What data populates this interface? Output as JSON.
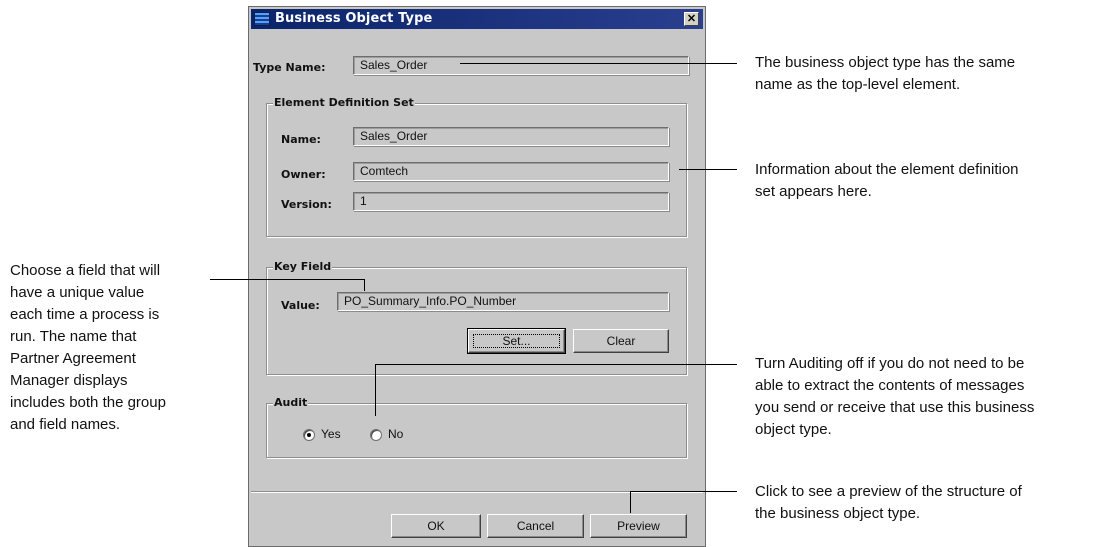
{
  "dialog": {
    "title": "Business Object Type",
    "close_glyph": "✕",
    "type_name": {
      "label": "Type Name:",
      "value": "Sales_Order"
    },
    "element_definition_set": {
      "title": "Element Definition Set",
      "name": {
        "label": "Name:",
        "value": "Sales_Order"
      },
      "owner": {
        "label": "Owner:",
        "value": "Comtech"
      },
      "version": {
        "label": "Version:",
        "value": "1"
      }
    },
    "key_field": {
      "title": "Key Field",
      "value": {
        "label": "Value:",
        "value": "PO_Summary_Info.PO_Number"
      },
      "set_label": "Set...",
      "clear_label": "Clear"
    },
    "audit": {
      "title": "Audit",
      "options": [
        {
          "label": "Yes",
          "selected": true
        },
        {
          "label": "No",
          "selected": false
        }
      ]
    },
    "buttons": {
      "ok": "OK",
      "cancel": "Cancel",
      "preview": "Preview"
    }
  },
  "callouts": {
    "type_name": [
      "The business object type has the same",
      "name as the top-level element."
    ],
    "element_definition": [
      "Information about the element definition",
      "set appears here."
    ],
    "key_field": [
      "Choose a field that will",
      "have a unique value",
      "each time a process is",
      "run. The name that",
      "Partner Agreement",
      "Manager displays",
      "includes both the group",
      "and field names."
    ],
    "audit": [
      "Turn Auditing off if you do not need to be",
      "able to extract the contents of messages",
      "you send or receive that use this business",
      "object type."
    ],
    "preview": [
      "Click to see a preview of the structure of",
      "the business object type."
    ]
  },
  "icons": {
    "title_icon": "window-app-icon",
    "radio_checked": "radio-selected-icon",
    "radio_unchecked": "radio-unselected-icon"
  }
}
